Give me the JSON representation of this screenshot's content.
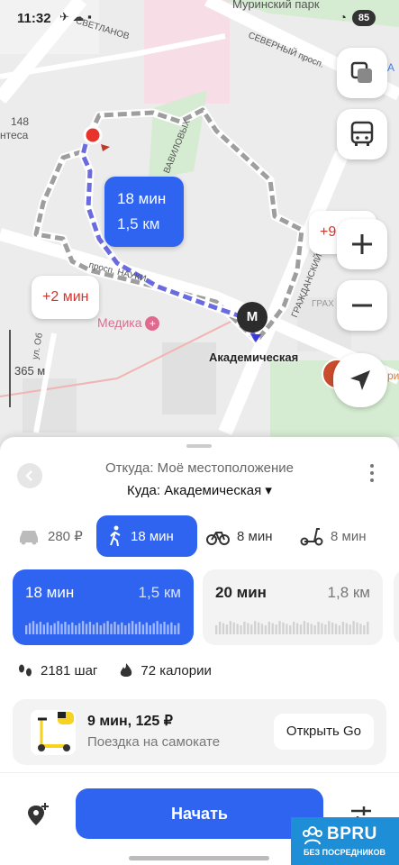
{
  "status_bar": {
    "time": "11:32",
    "battery": "85"
  },
  "map": {
    "labels": {
      "murinsky_park": "Муринский парк",
      "svetlanovsky": "СВЕТЛАНОВ",
      "severny_prosp": "СЕВЕРНЫЙ просп.",
      "vavilovykh": "ВАВИЛОВЫХ",
      "nauki": "просп. НАУКИ",
      "grazhdansky": "ГРАЖДАНСКИЙ",
      "gram": "ГРАХ",
      "obr": "ул. Об",
      "house": "148",
      "antesa": "нтеса",
      "medika": "Медика",
      "right_edge_a": "А",
      "right_edge_ri": "ри"
    },
    "route_bubble": {
      "time": "18 мин",
      "distance": "1,5 км"
    },
    "alt_bubble_left": "+2 мин",
    "alt_bubble_right": "+9 мин",
    "metro_letter": "М",
    "metro_station": "Академическая",
    "scale": "365 м",
    "colors": {
      "route": "#2f64f0",
      "alt_route": "#9e9e9e",
      "accent": "#2f64f0",
      "penalty": "#d9332b"
    }
  },
  "sheet": {
    "from": "Откуда: Моё местоположение",
    "to": "Куда: Академическая ▾",
    "modes": [
      {
        "icon": "car-icon",
        "label": "280 ₽"
      },
      {
        "icon": "walk-icon",
        "label": "18 мин"
      },
      {
        "icon": "bike-icon",
        "label": "8 мин"
      },
      {
        "icon": "scooter-icon",
        "label": "8 мин"
      }
    ],
    "routes": [
      {
        "time": "18 мин",
        "distance": "1,5 км",
        "selected": true
      },
      {
        "time": "20 мин",
        "distance": "1,8 км",
        "selected": false
      }
    ],
    "stats": {
      "steps": "2181 шаг",
      "calories": "72 калории"
    },
    "promo": {
      "title": "9 мин, 125 ₽",
      "subtitle": "Поездка на самокате",
      "button": "Открыть Go"
    },
    "start_button": "Начать"
  },
  "watermark": {
    "brand": "BPRU",
    "tagline": "БЕЗ ПОСРЕДНИКОВ"
  }
}
